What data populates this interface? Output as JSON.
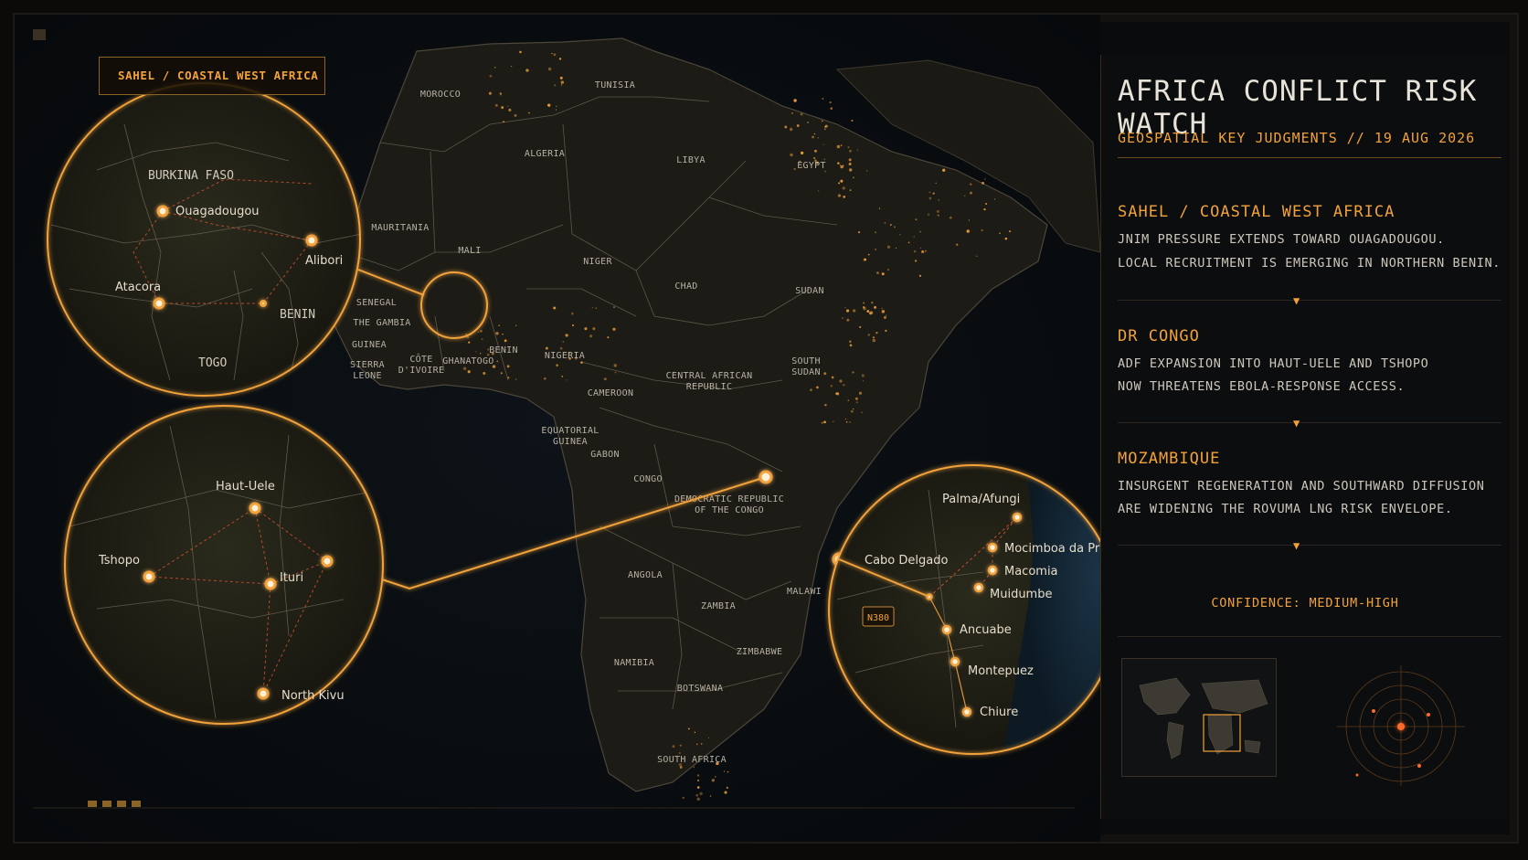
{
  "colors": {
    "accent": "#f2a23a",
    "glow": "#ffb455",
    "land": "#1d1c17",
    "ocean": "#0a0f14"
  },
  "callout_tag": "SAHEL / COASTAL WEST AFRICA",
  "panel": {
    "title": "AFRICA CONFLICT RISK WATCH",
    "subtitle": "GEOSPATIAL KEY JUDGMENTS // 19 AUG 2026",
    "sections": [
      {
        "heading": "SAHEL / COASTAL WEST AFRICA",
        "lines": [
          "JNIM PRESSURE EXTENDS TOWARD OUAGADOUGOU.",
          "LOCAL RECRUITMENT IS EMERGING IN NORTHERN BENIN."
        ]
      },
      {
        "heading": "DR CONGO",
        "lines": [
          "ADF EXPANSION INTO HAUT-UELE AND TSHOPO",
          "NOW THREATENS EBOLA-RESPONSE ACCESS."
        ]
      },
      {
        "heading": "MOZAMBIQUE",
        "lines": [
          "INSURGENT REGENERATION AND SOUTHWARD DIFFUSION",
          "ARE WIDENING THE ROVUMA LNG RISK ENVELOPE."
        ]
      }
    ],
    "confidence": "CONFIDENCE: MEDIUM-HIGH"
  },
  "country_labels": [
    {
      "id": "morocco",
      "lines": [
        "MOROCCO"
      ]
    },
    {
      "id": "tunisia",
      "lines": [
        "TUNISIA"
      ]
    },
    {
      "id": "algeria",
      "lines": [
        "ALGERIA"
      ]
    },
    {
      "id": "libya",
      "lines": [
        "LIBYA"
      ]
    },
    {
      "id": "egypt",
      "lines": [
        "EGYPT"
      ]
    },
    {
      "id": "mauritania",
      "lines": [
        "MAURITANIA"
      ]
    },
    {
      "id": "mali",
      "lines": [
        "MALI"
      ]
    },
    {
      "id": "niger",
      "lines": [
        "NIGER"
      ]
    },
    {
      "id": "chad",
      "lines": [
        "CHAD"
      ]
    },
    {
      "id": "sudan",
      "lines": [
        "SUDAN"
      ]
    },
    {
      "id": "senegal",
      "lines": [
        "SENEGAL"
      ]
    },
    {
      "id": "gambia",
      "lines": [
        "THE GAMBIA"
      ]
    },
    {
      "id": "guinea",
      "lines": [
        "GUINEA"
      ]
    },
    {
      "id": "sierra",
      "lines": [
        "SIERRA",
        "LEONE"
      ]
    },
    {
      "id": "cote",
      "lines": [
        "CÔTE",
        "D'IVOIRE"
      ]
    },
    {
      "id": "ghana",
      "lines": [
        "GHANA"
      ]
    },
    {
      "id": "togo",
      "lines": [
        "TOGO"
      ]
    },
    {
      "id": "benin",
      "lines": [
        "BENIN"
      ]
    },
    {
      "id": "nigeria",
      "lines": [
        "NIGERIA"
      ]
    },
    {
      "id": "cameroon",
      "lines": [
        "CAMEROON"
      ]
    },
    {
      "id": "car",
      "lines": [
        "CENTRAL AFRICAN",
        "REPUBLIC"
      ]
    },
    {
      "id": "ssudan",
      "lines": [
        "SOUTH",
        "SUDAN"
      ]
    },
    {
      "id": "eqguinea",
      "lines": [
        "EQUATORIAL",
        "GUINEA"
      ]
    },
    {
      "id": "gabon",
      "lines": [
        "GABON"
      ]
    },
    {
      "id": "congo",
      "lines": [
        "CONGO"
      ]
    },
    {
      "id": "drc",
      "lines": [
        "DEMOCRATIC REPUBLIC",
        "OF THE CONGO"
      ]
    },
    {
      "id": "angola",
      "lines": [
        "ANGOLA"
      ]
    },
    {
      "id": "zambia",
      "lines": [
        "ZAMBIA"
      ]
    },
    {
      "id": "malawi",
      "lines": [
        "MALAWI"
      ]
    },
    {
      "id": "zimbabwe",
      "lines": [
        "ZIMBABWE"
      ]
    },
    {
      "id": "namibia",
      "lines": [
        "NAMIBIA"
      ]
    },
    {
      "id": "botswana",
      "lines": [
        "BOTSWANA"
      ]
    },
    {
      "id": "safrica",
      "lines": [
        "SOUTH AFRICA"
      ]
    }
  ],
  "inset_sahel": {
    "countries": [
      "BURKINA FASO",
      "BENIN",
      "TOGO"
    ],
    "places": [
      "Ouagadougou",
      "Alibori",
      "Atacora"
    ]
  },
  "inset_drc": {
    "places": [
      "Haut-Uele",
      "Tshopo",
      "Ituri",
      "North Kivu"
    ]
  },
  "inset_moz": {
    "places": [
      "Palma/Afungi",
      "Cabo Delgado",
      "Mocimboa da Praia",
      "Macomia",
      "Muidumbe",
      "Ancuabe",
      "Montepuez",
      "Chiure"
    ],
    "road_label": "N380"
  }
}
